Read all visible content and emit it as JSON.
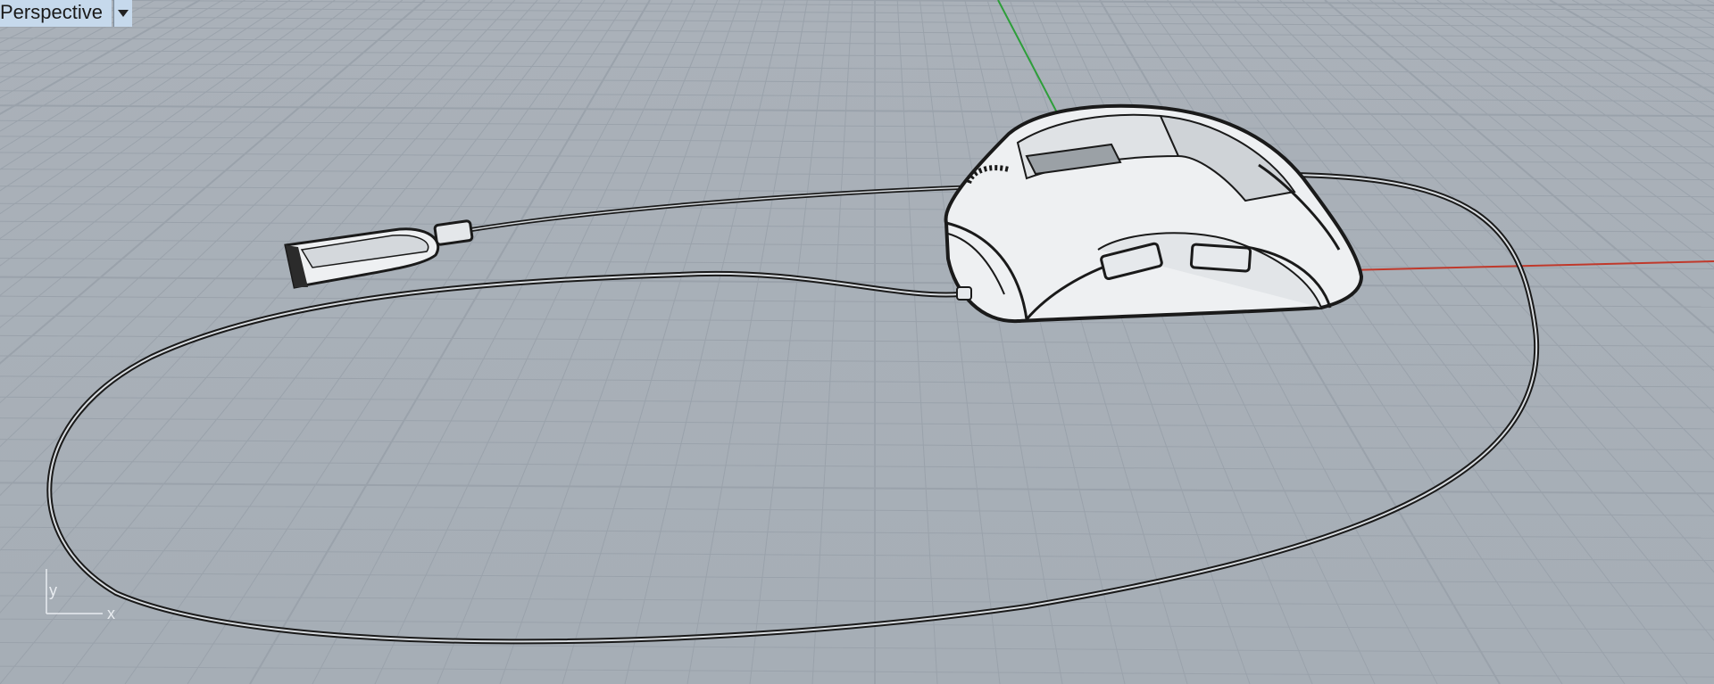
{
  "viewport": {
    "title": "Perspective",
    "menu_icon": "chevron-down-icon"
  },
  "world_axes": {
    "x_axis_color": "#c0392b",
    "y_axis_color": "#2e9e3a"
  },
  "axis_gizmo": {
    "x_label": "x",
    "y_label": "y"
  },
  "colors": {
    "background": "#aab1b9",
    "grid_line": "#9aa2ab",
    "model_outline": "#1a1a1a",
    "model_fill": "#eef0f2"
  }
}
